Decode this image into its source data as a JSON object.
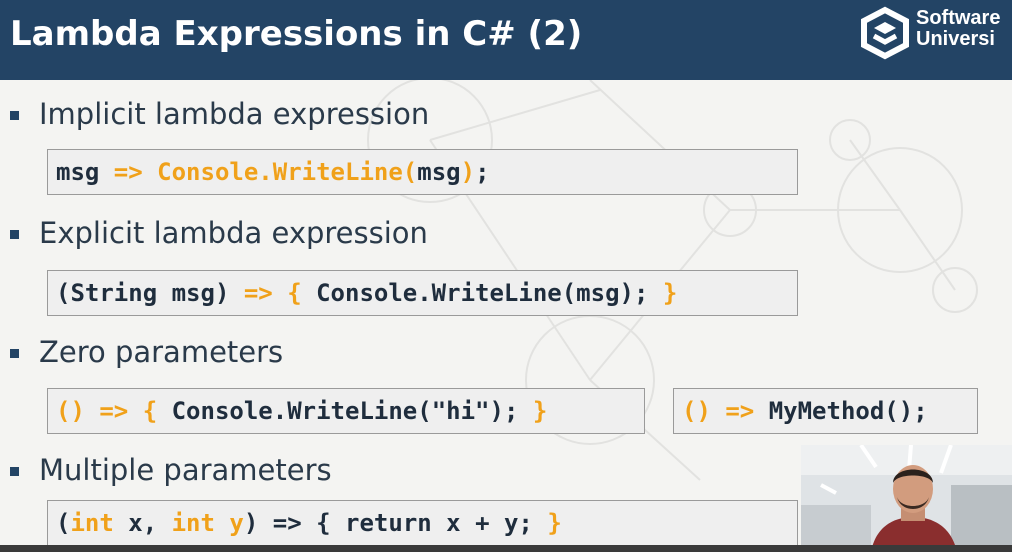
{
  "slide": {
    "title": "Lambda Expressions in C# (2)",
    "logo": {
      "line1": "Software",
      "line2": "Universi"
    },
    "sections": [
      {
        "heading": "Implicit lambda expression",
        "code": [
          {
            "parts": [
              "msg ",
              "=> ",
              "Console.WriteLine(",
              "msg",
              ")",
              ";"
            ]
          }
        ]
      },
      {
        "heading": "Explicit lambda expression",
        "code": [
          {
            "parts": [
              "(String msg) ",
              "=> {",
              " Console.WriteLine(msg); ",
              "}"
            ]
          }
        ]
      },
      {
        "heading": "Zero parameters",
        "code": [
          {
            "parts": [
              "() => {",
              " Console.WriteLine(\"hi\"); ",
              "}"
            ]
          },
          {
            "parts": [
              "() => ",
              "MyMethod();"
            ]
          }
        ]
      },
      {
        "heading": "Multiple parameters",
        "code": [
          {
            "parts": [
              "(",
              "int",
              " x, ",
              "int",
              " y",
              ") => {",
              " return x + y; ",
              "}"
            ]
          }
        ]
      }
    ]
  },
  "colors": {
    "header_bg": "#234465",
    "keyword_orange": "#f0a11a",
    "code_text": "#1f2d3d"
  },
  "icons": [
    "software-university-logo-icon",
    "bullet-square-icon"
  ]
}
